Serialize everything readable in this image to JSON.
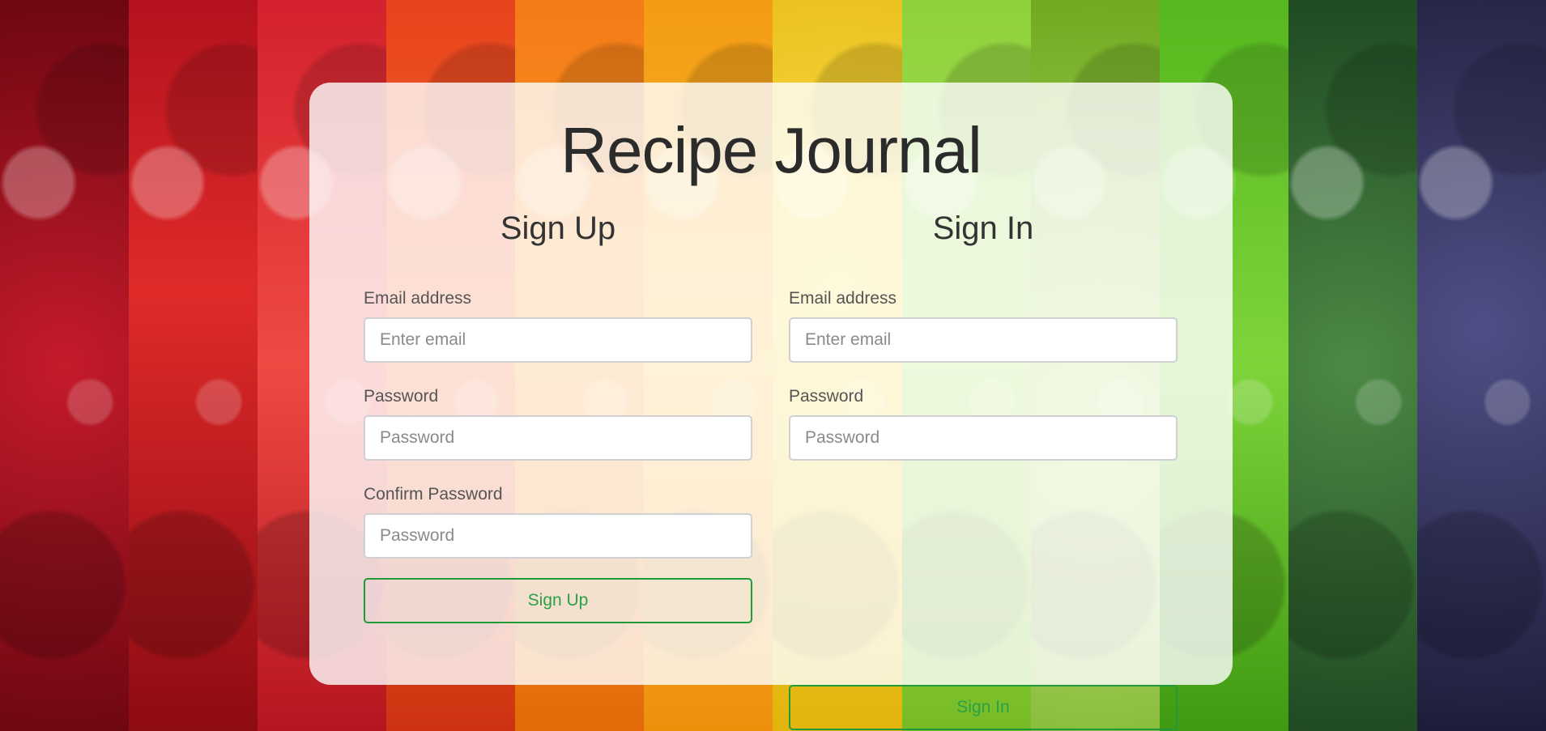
{
  "app": {
    "title": "Recipe Journal"
  },
  "signup": {
    "heading": "Sign Up",
    "email_label": "Email address",
    "email_placeholder": "Enter email",
    "email_value": "",
    "password_label": "Password",
    "password_placeholder": "Password",
    "password_value": "",
    "confirm_label": "Confirm Password",
    "confirm_placeholder": "Password",
    "confirm_value": "",
    "button_label": "Sign Up"
  },
  "signin": {
    "heading": "Sign In",
    "email_label": "Email address",
    "email_placeholder": "Enter email",
    "email_value": "",
    "password_label": "Password",
    "password_placeholder": "Password",
    "password_value": "",
    "button_label": "Sign In"
  },
  "theme": {
    "accent": "#1f9b3a",
    "card_background": "rgba(255,255,255,0.80)",
    "text": "#2b2b2b"
  },
  "background": {
    "stripes": [
      "pomegranate",
      "cherry",
      "strawberry",
      "tomato",
      "carrot",
      "orange",
      "corn",
      "lime",
      "kiwi",
      "lettuce",
      "broccoli",
      "plum"
    ]
  }
}
